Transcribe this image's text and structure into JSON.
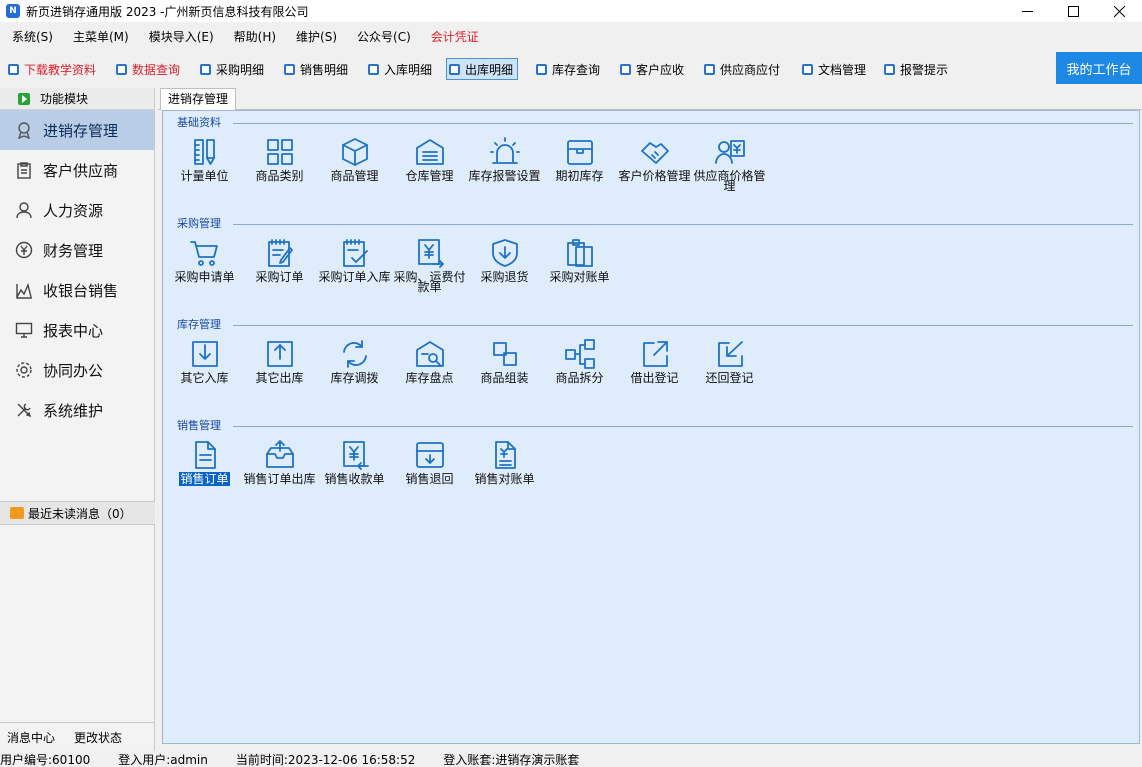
{
  "window": {
    "title": "新页进销存通用版 2023 -广州新页信息科技有限公司",
    "icon": "app-icon"
  },
  "menu": [
    "系统(S)",
    "主菜单(M)",
    "模块导入(E)",
    "帮助(H)",
    "维护(S)",
    "公众号(C)",
    "会计凭证"
  ],
  "toolbar": [
    {
      "label": "下载教学资料",
      "red": true
    },
    {
      "label": "数据查询",
      "red": true
    },
    {
      "label": "采购明细"
    },
    {
      "label": "销售明细"
    },
    {
      "label": "入库明细"
    },
    {
      "label": "出库明细",
      "active": true
    },
    {
      "label": "库存查询"
    },
    {
      "label": "客户应收"
    },
    {
      "label": "供应商应付"
    },
    {
      "label": "文档管理"
    },
    {
      "label": "报警提示"
    }
  ],
  "workbench_label": "我的工作台",
  "sidebar": {
    "header": "功能模块",
    "items": [
      {
        "label": "进销存管理",
        "icon": "badge-icon",
        "active": true
      },
      {
        "label": "客户供应商",
        "icon": "clipboard-icon"
      },
      {
        "label": "人力资源",
        "icon": "person-icon"
      },
      {
        "label": "财务管理",
        "icon": "coin-icon"
      },
      {
        "label": "收银台销售",
        "icon": "chart-icon"
      },
      {
        "label": "报表中心",
        "icon": "monitor-icon"
      },
      {
        "label": "协同办公",
        "icon": "gear-icon"
      },
      {
        "label": "系统维护",
        "icon": "tools-icon"
      }
    ],
    "unread": "最近未读消息（0）",
    "footer": [
      "消息中心",
      "更改状态"
    ]
  },
  "tab": "进销存管理",
  "groups": [
    {
      "title": "基础资料",
      "items": [
        {
          "label": "计量单位",
          "icon": "ruler-icon"
        },
        {
          "label": "商品类别",
          "icon": "grid-icon"
        },
        {
          "label": "商品管理",
          "icon": "box-icon"
        },
        {
          "label": "仓库管理",
          "icon": "warehouse-icon"
        },
        {
          "label": "库存报警设置",
          "icon": "alarm-icon"
        },
        {
          "label": "期初库存",
          "icon": "stock-box-icon"
        },
        {
          "label": "客户价格管理",
          "icon": "handshake-icon"
        },
        {
          "label": "供应商价格管理",
          "icon": "supplier-price-icon"
        }
      ]
    },
    {
      "title": "采购管理",
      "items": [
        {
          "label": "采购申请单",
          "icon": "cart-icon"
        },
        {
          "label": "采购订单",
          "icon": "order-edit-icon"
        },
        {
          "label": "采购订单入库",
          "icon": "order-check-icon"
        },
        {
          "label": "采购、运费付款单",
          "icon": "payment-icon"
        },
        {
          "label": "采购退货",
          "icon": "return-shield-icon"
        },
        {
          "label": "采购对账单",
          "icon": "reconcile-icon"
        }
      ]
    },
    {
      "title": "库存管理",
      "items": [
        {
          "label": "其它入库",
          "icon": "inbound-icon"
        },
        {
          "label": "其它出库",
          "icon": "outbound-icon"
        },
        {
          "label": "库存调拨",
          "icon": "transfer-icon"
        },
        {
          "label": "库存盘点",
          "icon": "inventory-check-icon"
        },
        {
          "label": "商品组装",
          "icon": "assemble-icon"
        },
        {
          "label": "商品拆分",
          "icon": "split-icon"
        },
        {
          "label": "借出登记",
          "icon": "lend-icon"
        },
        {
          "label": "还回登记",
          "icon": "return-icon"
        }
      ]
    },
    {
      "title": "销售管理",
      "items": [
        {
          "label": "销售订单",
          "icon": "sales-order-icon",
          "selected": true
        },
        {
          "label": "销售订单出库",
          "icon": "sales-out-icon"
        },
        {
          "label": "销售收款单",
          "icon": "receipt-icon"
        },
        {
          "label": "销售退回",
          "icon": "sales-return-icon"
        },
        {
          "label": "销售对账单",
          "icon": "sales-reconcile-icon"
        }
      ]
    }
  ],
  "status": {
    "user_no": "用户编号:60100",
    "login_user": "登入用户:admin",
    "time": "当前时间:2023-12-06 16:58:52",
    "account": "登入账套:进销存演示账套"
  },
  "colors": {
    "accent": "#1e88e5",
    "icon_blue": "#1e73c8",
    "menu_red": "#e0202a",
    "content_bg": "#deecfb"
  }
}
